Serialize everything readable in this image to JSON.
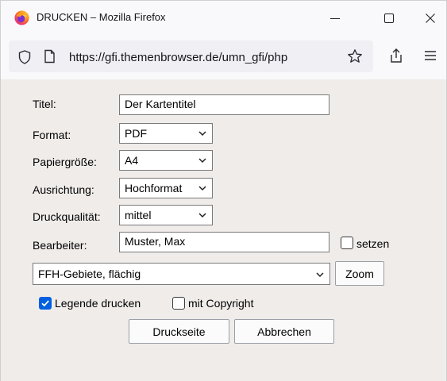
{
  "window": {
    "title": "DRUCKEN – Mozilla Firefox",
    "url": "https://gfi.themenbrowser.de/umn_gfi/php"
  },
  "form": {
    "title_label": "Titel:",
    "title_value": "Der Kartentitel",
    "format_label": "Format:",
    "format_value": "PDF",
    "paper_label": "Papiergröße:",
    "paper_value": "A4",
    "orientation_label": "Ausrichtung:",
    "orientation_value": "Hochformat",
    "quality_label": "Druckqualität:",
    "quality_value": "mittel",
    "editor_label": "Bearbeiter:",
    "editor_value": "Muster, Max",
    "set_label": "setzen",
    "set_checked": false,
    "layer_value": "FFH-Gebiete, flächig",
    "zoom_label": "Zoom",
    "legend_label": "Legende drucken",
    "legend_checked": true,
    "copyright_label": "mit Copyright",
    "copyright_checked": false,
    "print_label": "Druckseite",
    "cancel_label": "Abbrechen"
  },
  "colors": {
    "checkbox_accent": "#0060df",
    "content_background": "#efecea"
  },
  "icons": [
    "firefox-logo-icon",
    "minimize-icon",
    "maximize-icon",
    "close-icon",
    "shield-icon",
    "page-icon",
    "star-icon",
    "share-icon",
    "menu-icon",
    "chevron-down-icon",
    "checkmark-icon"
  ]
}
